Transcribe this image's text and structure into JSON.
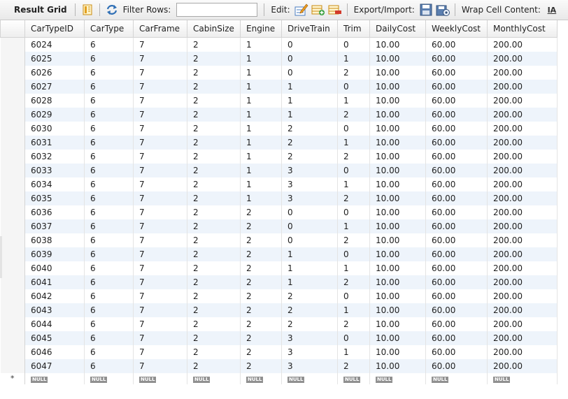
{
  "toolbar": {
    "title": "Result Grid",
    "filter_label": "Filter Rows:",
    "filter_value": "",
    "edit_label": "Edit:",
    "export_label": "Export/Import:",
    "wrap_label": "Wrap Cell Content:",
    "wrap_icon_text": "IA"
  },
  "grid": {
    "columns": [
      "CarTypeID",
      "CarType",
      "CarFrame",
      "CabinSize",
      "Engine",
      "DriveTrain",
      "Trim",
      "DailyCost",
      "WeeklyCost",
      "MonthlyCost"
    ],
    "rows": [
      [
        "6024",
        "6",
        "7",
        "2",
        "1",
        "0",
        "0",
        "10.00",
        "60.00",
        "200.00"
      ],
      [
        "6025",
        "6",
        "7",
        "2",
        "1",
        "0",
        "1",
        "10.00",
        "60.00",
        "200.00"
      ],
      [
        "6026",
        "6",
        "7",
        "2",
        "1",
        "0",
        "2",
        "10.00",
        "60.00",
        "200.00"
      ],
      [
        "6027",
        "6",
        "7",
        "2",
        "1",
        "1",
        "0",
        "10.00",
        "60.00",
        "200.00"
      ],
      [
        "6028",
        "6",
        "7",
        "2",
        "1",
        "1",
        "1",
        "10.00",
        "60.00",
        "200.00"
      ],
      [
        "6029",
        "6",
        "7",
        "2",
        "1",
        "1",
        "2",
        "10.00",
        "60.00",
        "200.00"
      ],
      [
        "6030",
        "6",
        "7",
        "2",
        "1",
        "2",
        "0",
        "10.00",
        "60.00",
        "200.00"
      ],
      [
        "6031",
        "6",
        "7",
        "2",
        "1",
        "2",
        "1",
        "10.00",
        "60.00",
        "200.00"
      ],
      [
        "6032",
        "6",
        "7",
        "2",
        "1",
        "2",
        "2",
        "10.00",
        "60.00",
        "200.00"
      ],
      [
        "6033",
        "6",
        "7",
        "2",
        "1",
        "3",
        "0",
        "10.00",
        "60.00",
        "200.00"
      ],
      [
        "6034",
        "6",
        "7",
        "2",
        "1",
        "3",
        "1",
        "10.00",
        "60.00",
        "200.00"
      ],
      [
        "6035",
        "6",
        "7",
        "2",
        "1",
        "3",
        "2",
        "10.00",
        "60.00",
        "200.00"
      ],
      [
        "6036",
        "6",
        "7",
        "2",
        "2",
        "0",
        "0",
        "10.00",
        "60.00",
        "200.00"
      ],
      [
        "6037",
        "6",
        "7",
        "2",
        "2",
        "0",
        "1",
        "10.00",
        "60.00",
        "200.00"
      ],
      [
        "6038",
        "6",
        "7",
        "2",
        "2",
        "0",
        "2",
        "10.00",
        "60.00",
        "200.00"
      ],
      [
        "6039",
        "6",
        "7",
        "2",
        "2",
        "1",
        "0",
        "10.00",
        "60.00",
        "200.00"
      ],
      [
        "6040",
        "6",
        "7",
        "2",
        "2",
        "1",
        "1",
        "10.00",
        "60.00",
        "200.00"
      ],
      [
        "6041",
        "6",
        "7",
        "2",
        "2",
        "1",
        "2",
        "10.00",
        "60.00",
        "200.00"
      ],
      [
        "6042",
        "6",
        "7",
        "2",
        "2",
        "2",
        "0",
        "10.00",
        "60.00",
        "200.00"
      ],
      [
        "6043",
        "6",
        "7",
        "2",
        "2",
        "2",
        "1",
        "10.00",
        "60.00",
        "200.00"
      ],
      [
        "6044",
        "6",
        "7",
        "2",
        "2",
        "2",
        "2",
        "10.00",
        "60.00",
        "200.00"
      ],
      [
        "6045",
        "6",
        "7",
        "2",
        "2",
        "3",
        "0",
        "10.00",
        "60.00",
        "200.00"
      ],
      [
        "6046",
        "6",
        "7",
        "2",
        "2",
        "3",
        "1",
        "10.00",
        "60.00",
        "200.00"
      ],
      [
        "6047",
        "6",
        "7",
        "2",
        "2",
        "3",
        "2",
        "10.00",
        "60.00",
        "200.00"
      ]
    ],
    "new_row_marker": "*",
    "null_label": "NULL"
  },
  "icons": {
    "form_editor": "form-editor-icon",
    "refresh": "refresh-icon",
    "edit_row": "edit-row-icon",
    "add_row": "add-row-icon",
    "delete_row": "delete-row-icon",
    "export": "export-icon",
    "import": "import-icon",
    "wrap": "wrap-cell-icon"
  },
  "colors": {
    "alt_row": "#eef4fb",
    "null_badge": "#909090"
  }
}
